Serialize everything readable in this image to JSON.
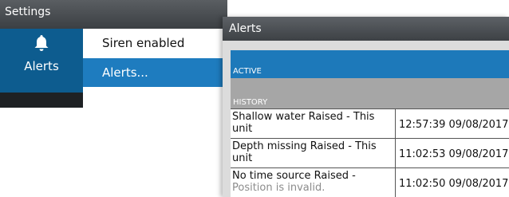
{
  "settings": {
    "title": "Settings",
    "side_items": [
      {
        "label": "Alerts",
        "icon": "bell-icon"
      }
    ],
    "menu": [
      {
        "label": "Siren enabled"
      },
      {
        "label": "Alerts..."
      }
    ]
  },
  "alerts": {
    "title": "Alerts",
    "active_header": "ACTIVE",
    "history_header": "HISTORY",
    "rows": [
      {
        "line1": "Shallow water  Raised -  This",
        "line2": "unit",
        "time": "12:57:39 09/08/2017"
      },
      {
        "line1": "Depth missing  Raised -  This",
        "line2": "unit",
        "time": "11:02:53 09/08/2017"
      },
      {
        "line1": "No time source Raised -",
        "line2": "Position is invalid.",
        "time": "11:02:50 09/08/2017"
      }
    ]
  },
  "colors": {
    "accent": "#1e7cbf",
    "titlebar": "#4a4e52",
    "sidebar": "#1e2124"
  }
}
